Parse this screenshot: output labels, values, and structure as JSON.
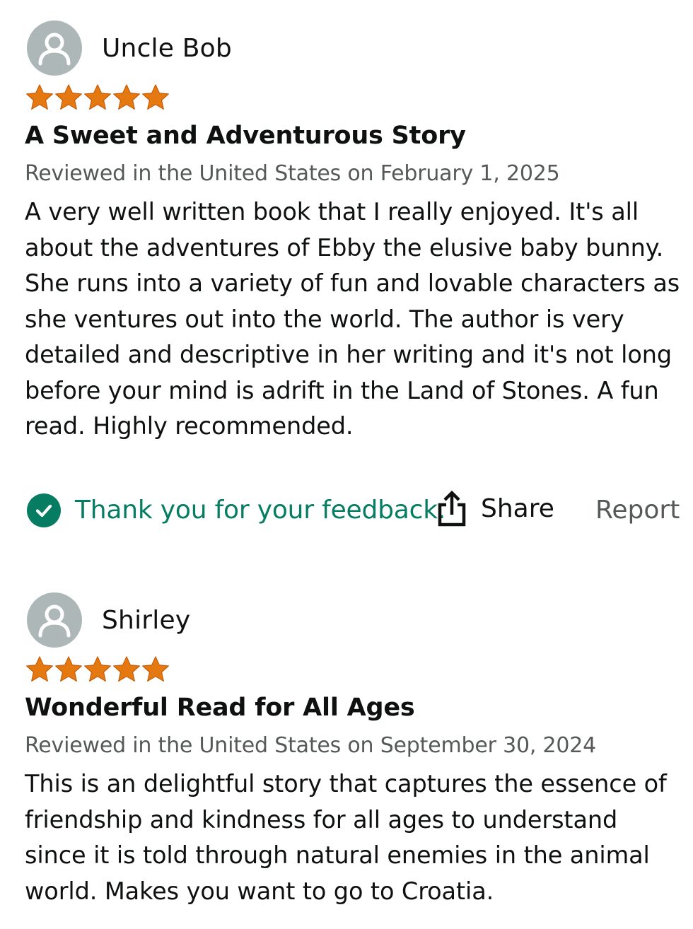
{
  "reviews": [
    {
      "author": "Uncle Bob",
      "rating": 5,
      "title": "A Sweet and Adventurous Story",
      "meta": "Reviewed in the United States on February 1, 2025",
      "body": "A very well written book that I really enjoyed. It's all about the adventures of Ebby the elusive baby bunny. She runs into a variety of fun and lovable characters as she ventures out into the world. The author is very detailed and descriptive in her writing and it's not long before your mind is adrift in the Land of Stones. A fun read. Highly recommended.",
      "feedback_text": "Thank you for your feedback.",
      "share_label": "Share",
      "report_label": "Report"
    },
    {
      "author": "Shirley",
      "rating": 5,
      "title": "Wonderful Read for All Ages",
      "meta": "Reviewed in the United States on September 30, 2024",
      "body": "This is an delightful story that captures the essence of friendship and kindness for all ages to understand since it is told through natural enemies in the animal world. Makes you want to go to Croatia."
    }
  ],
  "icons": {
    "avatar": "default-user-avatar-icon",
    "star": "star-icon",
    "check": "check-circle-icon",
    "share": "share-icon"
  },
  "colors": {
    "star": "#e47911",
    "feedback_green": "#067d62",
    "avatar_bg": "#adb7b7",
    "meta_gray": "#565959"
  }
}
